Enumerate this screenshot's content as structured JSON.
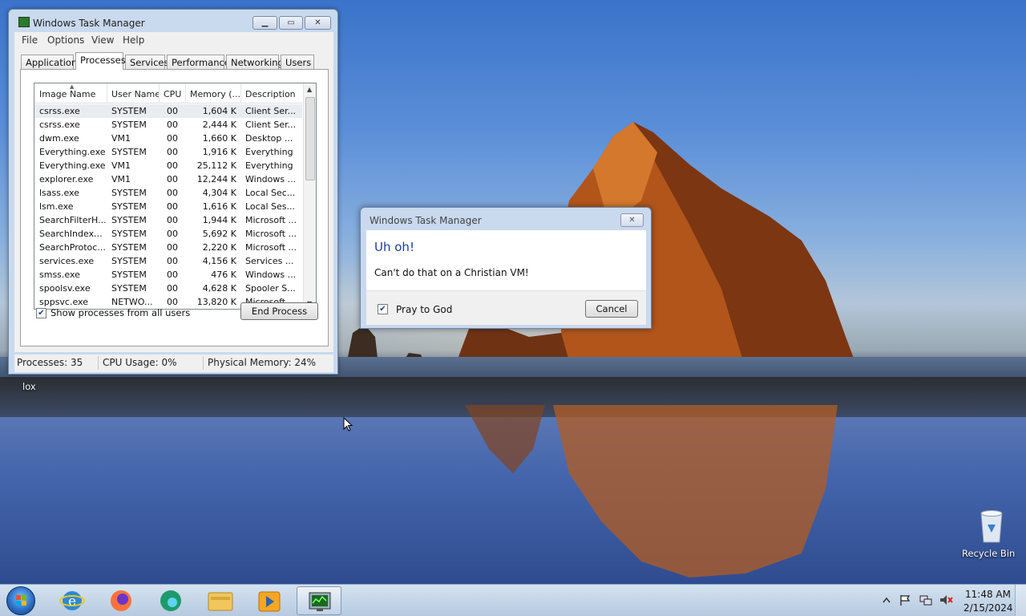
{
  "task_manager": {
    "title": "Windows Task Manager",
    "window_buttons": [
      "minimize",
      "maximize",
      "close"
    ],
    "menu": [
      "File",
      "Options",
      "View",
      "Help"
    ],
    "tabs": [
      "Applications",
      "Processes",
      "Services",
      "Performance",
      "Networking",
      "Users"
    ],
    "active_tab": "Processes",
    "columns": [
      "Image Name",
      "User Name",
      "CPU",
      "Memory (...",
      "Description"
    ],
    "rows": [
      [
        "csrss.exe",
        "SYSTEM",
        "00",
        "1,604 K",
        "Client Ser..."
      ],
      [
        "csrss.exe",
        "SYSTEM",
        "00",
        "2,444 K",
        "Client Ser..."
      ],
      [
        "dwm.exe",
        "VM1",
        "00",
        "1,660 K",
        "Desktop ..."
      ],
      [
        "Everything.exe",
        "SYSTEM",
        "00",
        "1,916 K",
        "Everything"
      ],
      [
        "Everything.exe",
        "VM1",
        "00",
        "25,112 K",
        "Everything"
      ],
      [
        "explorer.exe",
        "VM1",
        "00",
        "12,244 K",
        "Windows ..."
      ],
      [
        "lsass.exe",
        "SYSTEM",
        "00",
        "4,304 K",
        "Local Sec..."
      ],
      [
        "lsm.exe",
        "SYSTEM",
        "00",
        "1,616 K",
        "Local Ses..."
      ],
      [
        "SearchFilterH...",
        "SYSTEM",
        "00",
        "1,944 K",
        "Microsoft ..."
      ],
      [
        "SearchIndexe...",
        "SYSTEM",
        "00",
        "5,692 K",
        "Microsoft ..."
      ],
      [
        "SearchProtoc...",
        "SYSTEM",
        "00",
        "2,220 K",
        "Microsoft ..."
      ],
      [
        "services.exe",
        "SYSTEM",
        "00",
        "4,156 K",
        "Services ..."
      ],
      [
        "smss.exe",
        "SYSTEM",
        "00",
        "476 K",
        "Windows ..."
      ],
      [
        "spoolsv.exe",
        "SYSTEM",
        "00",
        "4,628 K",
        "Spooler S..."
      ],
      [
        "sppsvc.exe",
        "NETWO...",
        "00",
        "13,820 K",
        "Microsoft ..."
      ]
    ],
    "show_all_label": "Show processes from all users",
    "show_all_checked": true,
    "end_process_label": "End Process",
    "status": {
      "processes": "Processes: 35",
      "cpu": "CPU Usage: 0%",
      "memory": "Physical Memory: 24%"
    }
  },
  "dialog": {
    "title": "Windows Task Manager",
    "heading": "Uh oh!",
    "message": "Can't do that on a Christian VM!",
    "checkbox_label": "Pray to God",
    "checkbox_checked": true,
    "cancel_label": "Cancel"
  },
  "desktop": {
    "recycle_bin_label": "Recycle Bin",
    "partial_label": "lox"
  },
  "taskbar": {
    "pinned": [
      "start-orb",
      "ie-icon",
      "firefox-icon",
      "edge-icon",
      "explorer-icon",
      "media-player-icon",
      "task-manager-icon"
    ],
    "active": "task-manager-icon",
    "clock_time": "11:48 AM",
    "clock_date": "2/15/2024"
  }
}
